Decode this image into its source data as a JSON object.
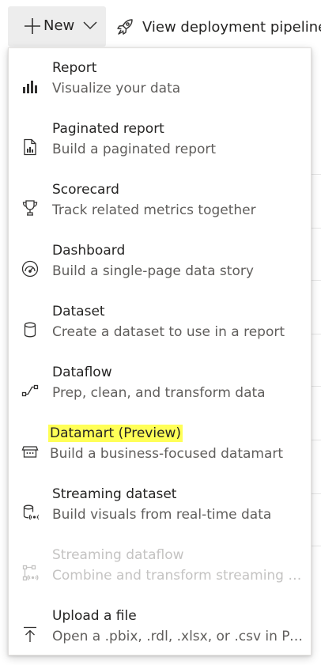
{
  "toolbar": {
    "new_label": "New",
    "deploy_label": "View deployment pipeline"
  },
  "menu": {
    "items": [
      {
        "title": "Report",
        "desc": "Visualize your data",
        "icon": "bar-chart-icon",
        "enabled": true
      },
      {
        "title": "Paginated report",
        "desc": "Build a paginated report",
        "icon": "paginated-report-icon",
        "enabled": true
      },
      {
        "title": "Scorecard",
        "desc": "Track related metrics together",
        "icon": "trophy-icon",
        "enabled": true
      },
      {
        "title": "Dashboard",
        "desc": "Build a single-page data story",
        "icon": "gauge-icon",
        "enabled": true
      },
      {
        "title": "Dataset",
        "desc": "Create a dataset to use in a report",
        "icon": "database-icon",
        "enabled": true
      },
      {
        "title": "Dataflow",
        "desc": "Prep, clean, and transform data",
        "icon": "dataflow-icon",
        "enabled": true
      },
      {
        "title": "Datamart (Preview)",
        "desc": "Build a business-focused datamart",
        "icon": "datamart-icon",
        "enabled": true,
        "highlighted": true,
        "highlight_color": "#ffff57"
      },
      {
        "title": "Streaming dataset",
        "desc": "Build visuals from real-time data",
        "icon": "streaming-database-icon",
        "enabled": true
      },
      {
        "title": "Streaming dataflow",
        "desc": "Combine and transform streaming data",
        "icon": "streaming-dataflow-icon",
        "enabled": false
      },
      {
        "title": "Upload a file",
        "desc": "Open a .pbix, .rdl, .xlsx, or .csv in Power BI",
        "icon": "upload-icon",
        "enabled": true
      }
    ]
  },
  "colors": {
    "button_bg": "#ededed",
    "text": "#252423",
    "secondary_text": "#605e5c",
    "disabled_text": "#c4c3c2",
    "highlight": "#ffff57"
  }
}
